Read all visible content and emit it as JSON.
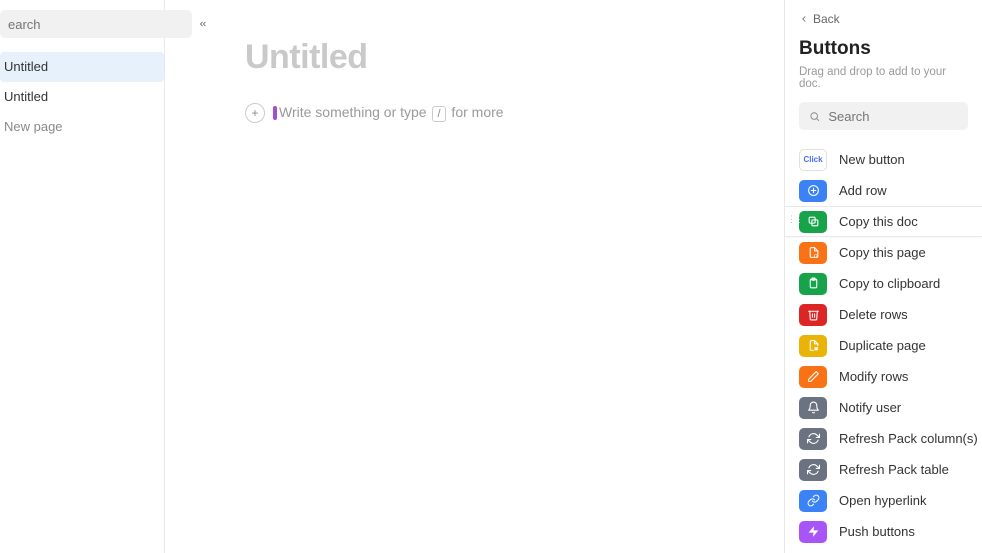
{
  "sidebar": {
    "search_placeholder": "earch",
    "pages": [
      {
        "label": "Untitled",
        "active": true
      },
      {
        "label": "Untitled",
        "active": false
      },
      {
        "label": "New page",
        "active": false,
        "faded": true
      }
    ]
  },
  "doc": {
    "title": "Untitled",
    "prompt_before": "Write something or type ",
    "prompt_key": "/",
    "prompt_after": " for more"
  },
  "panel": {
    "back_label": "Back",
    "title": "Buttons",
    "subtitle": "Drag and drop to add to your doc.",
    "search_placeholder": "Search",
    "items": [
      {
        "label": "New button",
        "color": "white",
        "icon": "click"
      },
      {
        "label": "Add row",
        "color": "blue",
        "icon": "plus-circle"
      },
      {
        "label": "Copy this doc",
        "color": "green",
        "icon": "copy",
        "hovered": true
      },
      {
        "label": "Copy this page",
        "color": "orange",
        "icon": "page-copy"
      },
      {
        "label": "Copy to clipboard",
        "color": "green",
        "icon": "clipboard"
      },
      {
        "label": "Delete rows",
        "color": "red",
        "icon": "trash"
      },
      {
        "label": "Duplicate page",
        "color": "yellow",
        "icon": "page-dup"
      },
      {
        "label": "Modify rows",
        "color": "orange",
        "icon": "pencil"
      },
      {
        "label": "Notify user",
        "color": "gray",
        "icon": "bell"
      },
      {
        "label": "Refresh Pack column(s)",
        "color": "gray",
        "icon": "refresh"
      },
      {
        "label": "Refresh Pack table",
        "color": "gray",
        "icon": "refresh"
      },
      {
        "label": "Open hyperlink",
        "color": "blue",
        "icon": "link"
      },
      {
        "label": "Push buttons",
        "color": "purple",
        "icon": "bolt"
      }
    ]
  }
}
